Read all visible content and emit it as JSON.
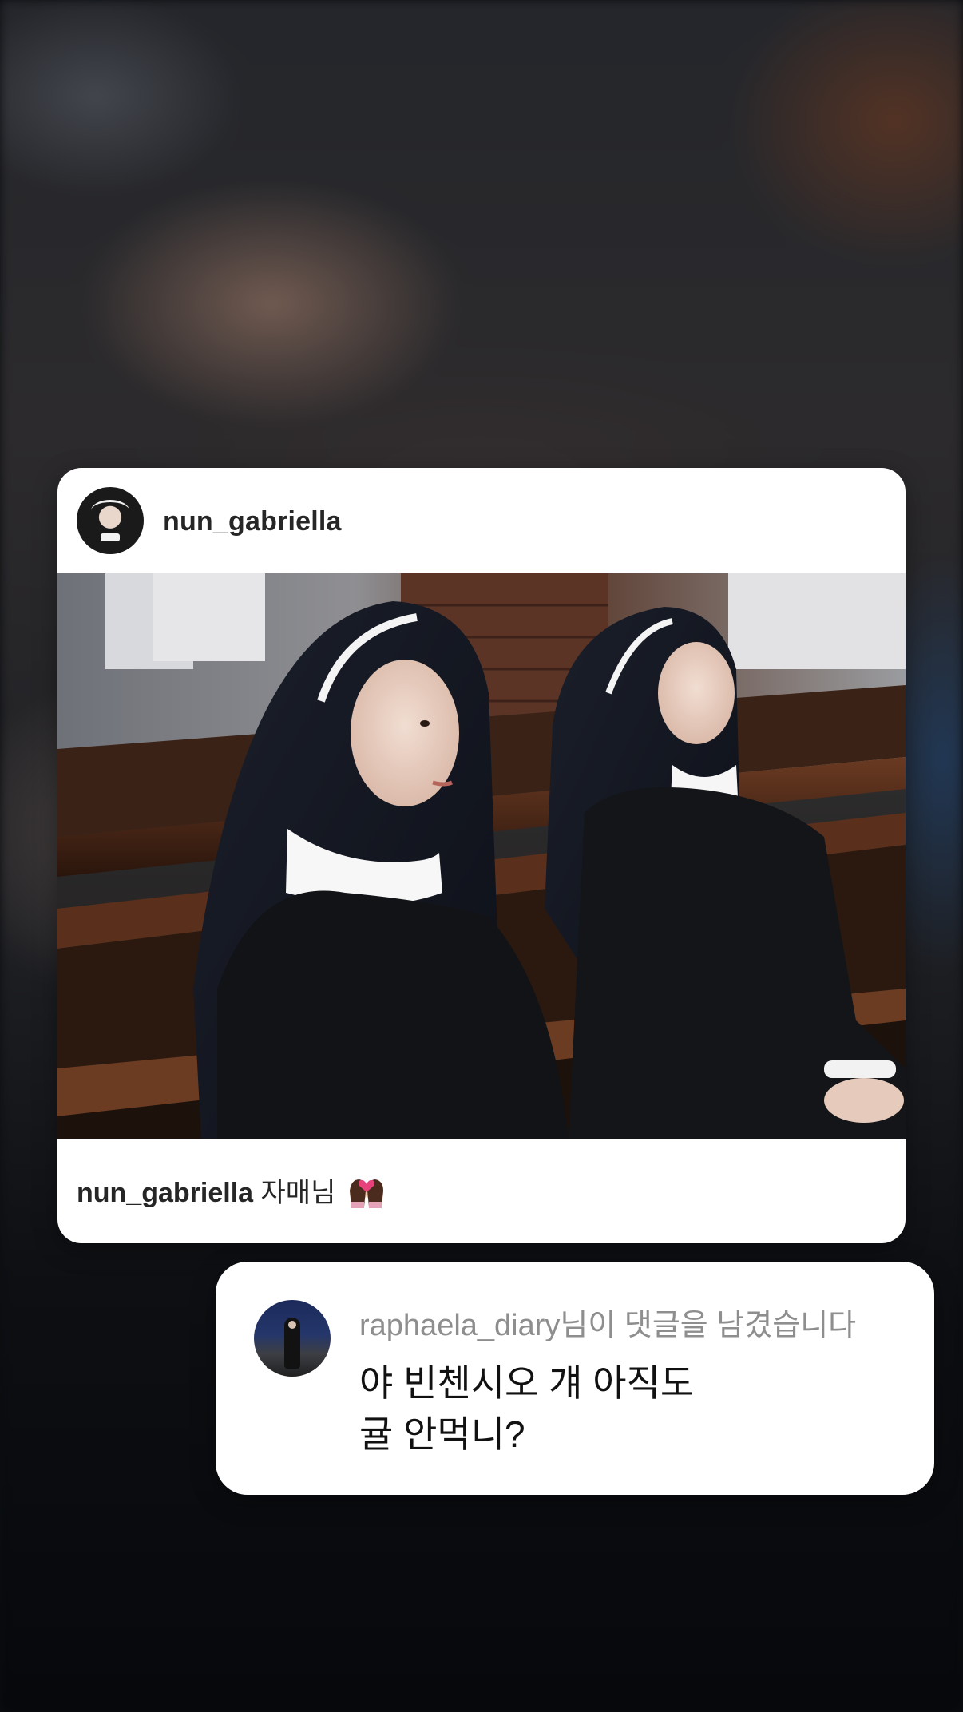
{
  "post": {
    "username": "nun_gabriella",
    "caption_user": "nun_gabriella",
    "caption_text": "자매님",
    "caption_emoji": "women-with-heart-emoji"
  },
  "comment": {
    "meta": "raphaela_diary님이 댓글을 남겼습니다",
    "text_line1": "야 빈첸시오 걔 아직도",
    "text_line2": "귤 안먹니?"
  },
  "colors": {
    "card_bg": "#ffffff",
    "username_text": "#262626",
    "meta_text": "#8e8e8e",
    "comment_text": "#111111"
  }
}
